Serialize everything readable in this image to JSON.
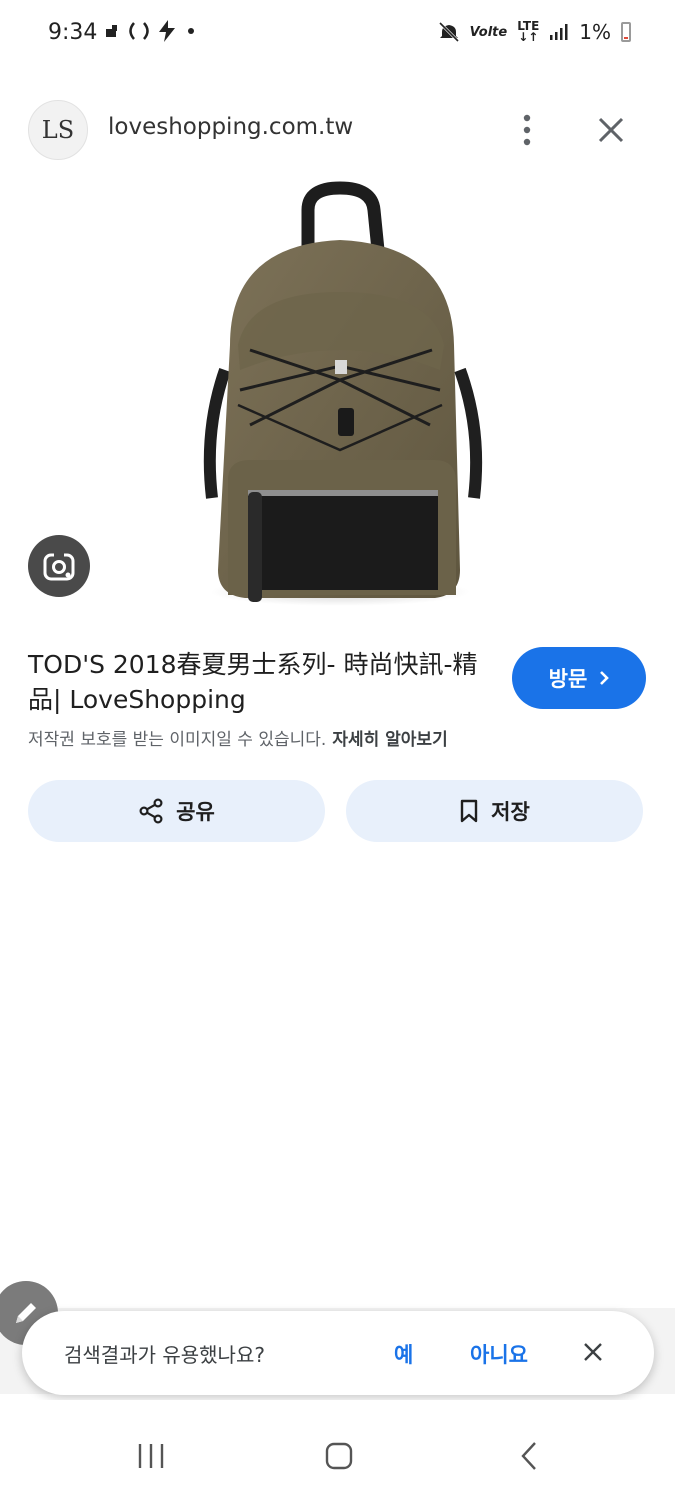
{
  "status_bar": {
    "time": "9:34",
    "battery_percent": "1%",
    "network_volte": "Volte",
    "network_lte": "LTE",
    "icons": [
      "notification-icon",
      "vpn-icon",
      "bolt-icon",
      "dot-icon",
      "mute-icon",
      "signal-icon",
      "battery-icon"
    ]
  },
  "header": {
    "logo_text": "LS",
    "domain": "loveshopping.com.tw",
    "icons": [
      "more-vert-icon",
      "close-icon"
    ]
  },
  "result": {
    "title": "TOD'S 2018春夏男士系列- 時尚快訊-精品| LoveShopping",
    "visit_label": "방문",
    "copyright_text": "저작권 보호를 받는 이미지일 수 있습니다.",
    "learn_more": "자세히 알아보기",
    "share_label": "공유",
    "save_label": "저장"
  },
  "feedback": {
    "question": "검색결과가 유용했나요?",
    "yes": "예",
    "no": "아니요"
  },
  "nav": {
    "icons": [
      "recent-apps-icon",
      "home-icon",
      "back-icon"
    ]
  },
  "colors": {
    "accent": "#1a73e8",
    "button_bg": "#e8f0fb",
    "secondary_text": "#5f6368"
  }
}
